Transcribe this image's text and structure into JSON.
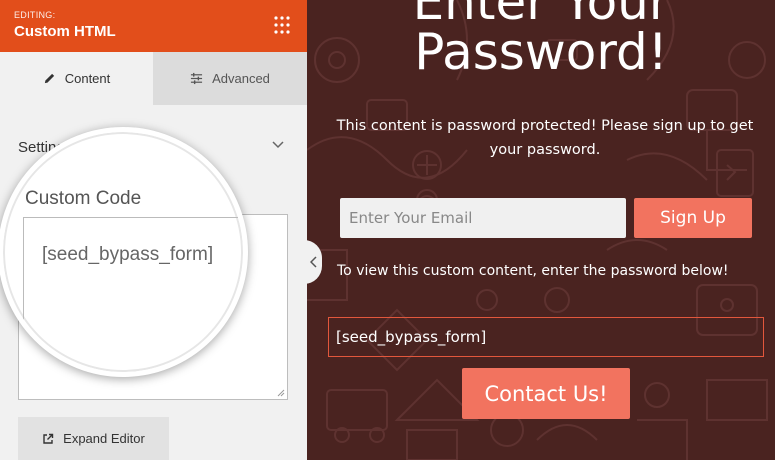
{
  "sidebar": {
    "editing_label": "EDITING:",
    "title": "Custom HTML",
    "tabs": [
      {
        "label": "Content",
        "icon": "pencil-icon"
      },
      {
        "label": "Advanced",
        "icon": "sliders-icon"
      }
    ],
    "settings_label": "Settings",
    "custom_code_label": "Custom Code",
    "custom_code_value": "[seed_bypass_form]",
    "expand_editor_label": "Expand Editor"
  },
  "preview": {
    "heading_line1": "Enter Your",
    "heading_line2": "Password!",
    "protected_text": "This content is password protected! Please sign up to get your password.",
    "email_placeholder": "Enter Your Email",
    "signup_label": "Sign Up",
    "view_text": "To view this custom content, enter the password below!",
    "bypass_shortcode": "[seed_bypass_form]",
    "contact_label": "Contact Us!"
  },
  "colors": {
    "header_orange": "#e24e1b",
    "preview_background": "#4a2320",
    "button_coral": "#f2735f",
    "bypass_border": "#e2573c"
  }
}
